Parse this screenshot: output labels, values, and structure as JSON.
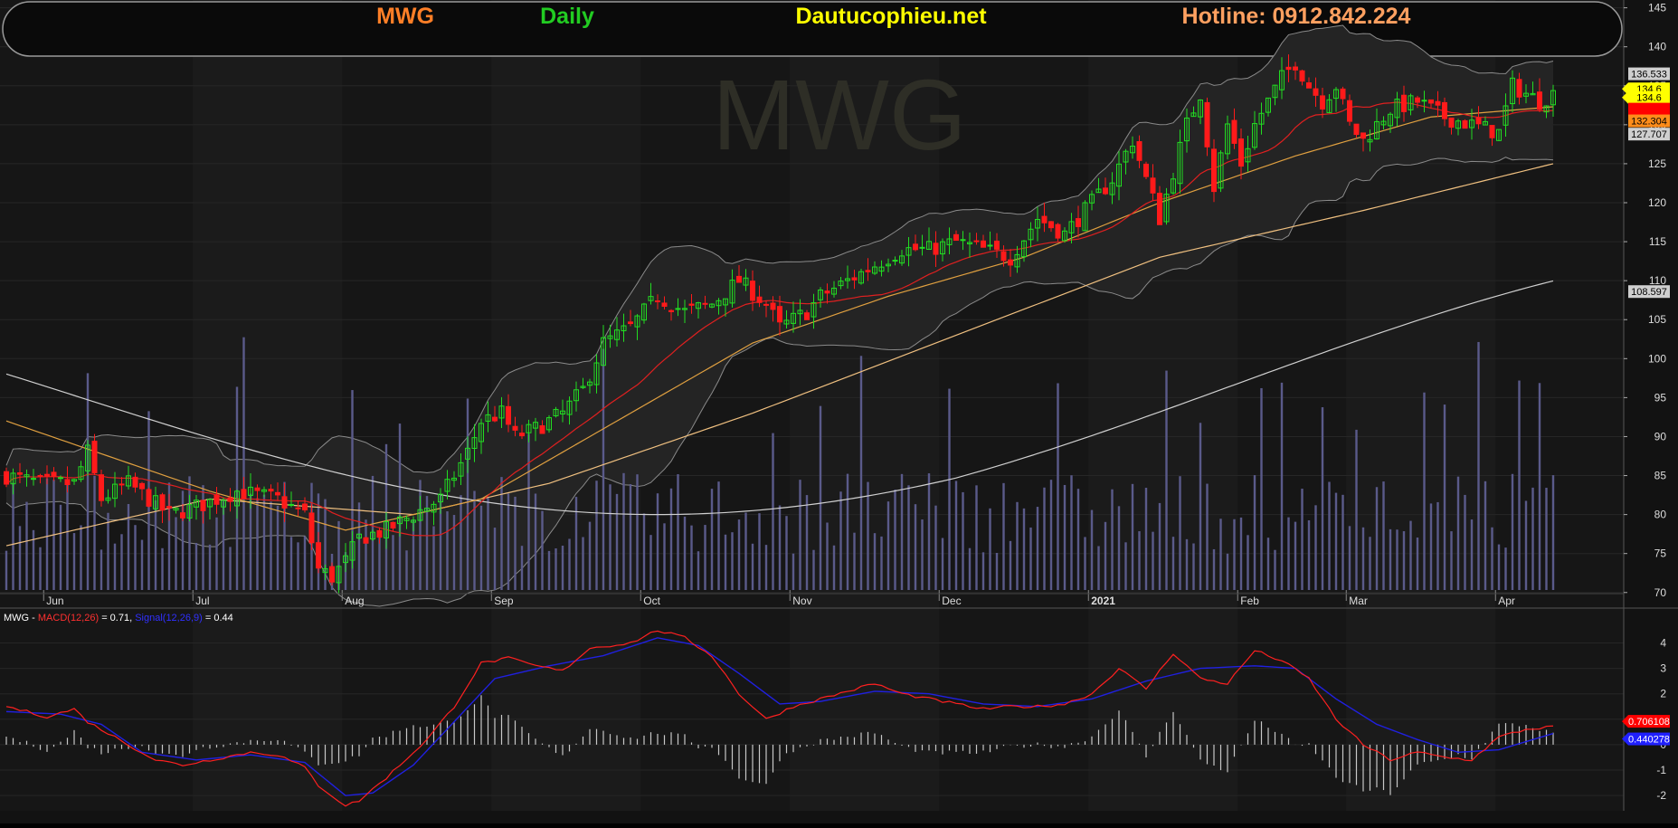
{
  "header": {
    "symbol": "MWG",
    "period": "Daily",
    "site": "Dautucophieu.net",
    "hotline": "Hotline: 0912.842.224",
    "symbol_color": "#ff7f27",
    "period_color": "#22cc22",
    "site_color": "#ffff00",
    "hotline_color": "#ffa060"
  },
  "watermark": "MWG",
  "macd_legend": {
    "symbol": "MWG",
    "sep": " - ",
    "macd_label": "MACD(12,26)",
    "macd_value": " = 0.71, ",
    "signal_label": "Signal(12,26,9)",
    "signal_value": " = 0.44"
  },
  "chart_data": [
    {
      "type": "candlestick",
      "title": "MWG Daily",
      "month_labels": [
        {
          "label": "Jun",
          "bar": 6
        },
        {
          "label": "Jul",
          "bar": 28
        },
        {
          "label": "Aug",
          "bar": 50
        },
        {
          "label": "Sep",
          "bar": 72
        },
        {
          "label": "Oct",
          "bar": 94
        },
        {
          "label": "Nov",
          "bar": 116
        },
        {
          "label": "Dec",
          "bar": 138
        },
        {
          "label": "2021",
          "bar": 160
        },
        {
          "label": "Feb",
          "bar": 182
        },
        {
          "label": "Mar",
          "bar": 198
        },
        {
          "label": "Apr",
          "bar": 220
        }
      ],
      "ylim": [
        68,
        146
      ],
      "yticks": [
        70,
        75,
        80,
        85,
        90,
        95,
        100,
        105,
        110,
        115,
        120,
        125,
        130,
        135,
        140,
        145
      ],
      "grid": true,
      "close_anchors": [
        [
          0,
          85
        ],
        [
          5,
          84
        ],
        [
          10,
          84
        ],
        [
          12,
          88
        ],
        [
          14,
          82
        ],
        [
          18,
          84
        ],
        [
          24,
          80
        ],
        [
          28,
          81
        ],
        [
          34,
          83
        ],
        [
          40,
          82
        ],
        [
          44,
          80
        ],
        [
          46,
          73
        ],
        [
          48,
          72
        ],
        [
          50,
          74
        ],
        [
          52,
          77
        ],
        [
          56,
          78
        ],
        [
          60,
          80
        ],
        [
          64,
          82
        ],
        [
          68,
          88
        ],
        [
          70,
          92
        ],
        [
          73,
          93
        ],
        [
          75,
          90
        ],
        [
          78,
          91
        ],
        [
          82,
          93
        ],
        [
          85,
          96
        ],
        [
          88,
          102
        ],
        [
          92,
          104
        ],
        [
          96,
          108
        ],
        [
          100,
          106
        ],
        [
          104,
          107
        ],
        [
          108,
          110
        ],
        [
          112,
          107
        ],
        [
          114,
          104
        ],
        [
          118,
          106
        ],
        [
          120,
          108
        ],
        [
          124,
          110
        ],
        [
          128,
          112
        ],
        [
          132,
          114
        ],
        [
          136,
          114
        ],
        [
          140,
          115
        ],
        [
          144,
          114
        ],
        [
          148,
          113
        ],
        [
          152,
          118
        ],
        [
          156,
          116
        ],
        [
          160,
          120
        ],
        [
          163,
          123
        ],
        [
          166,
          128
        ],
        [
          170,
          118
        ],
        [
          174,
          130
        ],
        [
          176,
          134
        ],
        [
          178,
          122
        ],
        [
          180,
          130
        ],
        [
          182,
          125
        ],
        [
          184,
          130
        ],
        [
          186,
          133
        ],
        [
          188,
          136
        ],
        [
          190,
          138
        ],
        [
          192,
          135
        ],
        [
          194,
          133
        ],
        [
          196,
          135
        ],
        [
          198,
          130
        ],
        [
          200,
          128
        ],
        [
          204,
          132
        ],
        [
          208,
          133
        ],
        [
          212,
          131
        ],
        [
          216,
          130
        ],
        [
          220,
          129
        ],
        [
          222,
          135
        ],
        [
          224,
          134
        ],
        [
          226,
          133
        ],
        [
          228,
          134
        ]
      ],
      "price_tags": [
        {
          "value": "136.533",
          "price": 136.533,
          "bg": "#cfcfcf",
          "fg": "#000000"
        },
        {
          "value": "134.6",
          "price": 134.6,
          "bg": "#ffff00",
          "fg": "#000000"
        },
        {
          "value": "134.6",
          "price": 133.5,
          "bg": "#ffff00",
          "fg": "#000000"
        },
        {
          "value": "132.315",
          "price": 132.0,
          "bg": "#ff0000",
          "fg": "#ff0000"
        },
        {
          "value": "132.304",
          "price": 130.5,
          "bg": "#ff8c1a",
          "fg": "#000000"
        },
        {
          "value": "127.707",
          "price": 128.8,
          "bg": "#cfcfcf",
          "fg": "#000000"
        },
        {
          "value": "108.597",
          "price": 108.6,
          "bg": "#cfcfcf",
          "fg": "#000000"
        }
      ],
      "series": [
        {
          "name": "Candles",
          "up_color": "#22dd22",
          "down_color": "#ff1a1a"
        },
        {
          "name": "MA20",
          "color": "#e02020"
        },
        {
          "name": "MA50",
          "color": "#e0a040"
        },
        {
          "name": "MA100",
          "color": "#f0c080"
        },
        {
          "name": "MA200",
          "color": "#d0d0d0"
        },
        {
          "name": "Bollinger",
          "color": "#8a8a8a",
          "fill": "#262626"
        },
        {
          "name": "Volume",
          "color": "#6a6a9a"
        }
      ]
    },
    {
      "type": "line",
      "title": "MACD(12,26)",
      "ylim": [
        -2.6,
        4.8
      ],
      "yticks": [
        4,
        3,
        2,
        1,
        0,
        -1,
        -2
      ],
      "ytick_labels": [
        "4",
        "3",
        "2",
        "1",
        "0",
        "-1",
        "-2"
      ],
      "macd_anchors": [
        [
          0,
          1.5
        ],
        [
          6,
          1.1
        ],
        [
          10,
          1.4
        ],
        [
          12,
          0.9
        ],
        [
          16,
          0.3
        ],
        [
          22,
          -0.6
        ],
        [
          26,
          -0.8
        ],
        [
          30,
          -0.6
        ],
        [
          36,
          -0.3
        ],
        [
          40,
          -0.4
        ],
        [
          44,
          -0.9
        ],
        [
          46,
          -1.6
        ],
        [
          50,
          -2.4
        ],
        [
          52,
          -2.2
        ],
        [
          56,
          -1.3
        ],
        [
          62,
          0.2
        ],
        [
          66,
          1.5
        ],
        [
          70,
          3.2
        ],
        [
          74,
          3.4
        ],
        [
          78,
          3.1
        ],
        [
          82,
          2.9
        ],
        [
          86,
          3.8
        ],
        [
          92,
          4.0
        ],
        [
          96,
          4.5
        ],
        [
          100,
          4.2
        ],
        [
          104,
          3.5
        ],
        [
          108,
          2.0
        ],
        [
          112,
          1.0
        ],
        [
          116,
          1.5
        ],
        [
          120,
          1.8
        ],
        [
          128,
          2.4
        ],
        [
          132,
          2.0
        ],
        [
          140,
          1.6
        ],
        [
          144,
          1.4
        ],
        [
          148,
          1.5
        ],
        [
          152,
          1.5
        ],
        [
          156,
          1.6
        ],
        [
          160,
          2.0
        ],
        [
          164,
          3.0
        ],
        [
          168,
          2.2
        ],
        [
          172,
          3.6
        ],
        [
          176,
          2.6
        ],
        [
          180,
          2.4
        ],
        [
          184,
          3.7
        ],
        [
          188,
          3.3
        ],
        [
          192,
          2.6
        ],
        [
          196,
          1.0
        ],
        [
          200,
          0.0
        ],
        [
          204,
          -0.6
        ],
        [
          208,
          -0.3
        ],
        [
          212,
          -0.5
        ],
        [
          216,
          -0.6
        ],
        [
          220,
          0.3
        ],
        [
          224,
          0.6
        ],
        [
          228,
          0.71
        ]
      ],
      "signal_anchors": [
        [
          0,
          1.3
        ],
        [
          8,
          1.2
        ],
        [
          14,
          0.8
        ],
        [
          20,
          -0.3
        ],
        [
          28,
          -0.6
        ],
        [
          36,
          -0.4
        ],
        [
          44,
          -0.7
        ],
        [
          50,
          -2.0
        ],
        [
          54,
          -1.9
        ],
        [
          60,
          -0.8
        ],
        [
          66,
          0.9
        ],
        [
          72,
          2.6
        ],
        [
          80,
          3.1
        ],
        [
          88,
          3.5
        ],
        [
          96,
          4.2
        ],
        [
          102,
          3.9
        ],
        [
          108,
          2.8
        ],
        [
          114,
          1.6
        ],
        [
          120,
          1.7
        ],
        [
          128,
          2.1
        ],
        [
          136,
          2.0
        ],
        [
          144,
          1.6
        ],
        [
          152,
          1.5
        ],
        [
          160,
          1.8
        ],
        [
          168,
          2.5
        ],
        [
          176,
          3.0
        ],
        [
          184,
          3.1
        ],
        [
          190,
          3.0
        ],
        [
          196,
          1.8
        ],
        [
          202,
          0.8
        ],
        [
          208,
          0.2
        ],
        [
          214,
          -0.3
        ],
        [
          220,
          -0.2
        ],
        [
          228,
          0.44
        ]
      ],
      "value_tags": [
        {
          "value": "0.706108",
          "macd": 0.706,
          "bg": "#ff0000",
          "fg": "#ffffff"
        },
        {
          "value": "0.440278",
          "macd": 0.44,
          "bg": "#2020ff",
          "fg": "#ffffff"
        }
      ],
      "series": [
        {
          "name": "MACD",
          "color": "#ff2020"
        },
        {
          "name": "Signal",
          "color": "#2020e0"
        },
        {
          "name": "Histogram",
          "color": "#c8c8c8"
        }
      ]
    }
  ]
}
